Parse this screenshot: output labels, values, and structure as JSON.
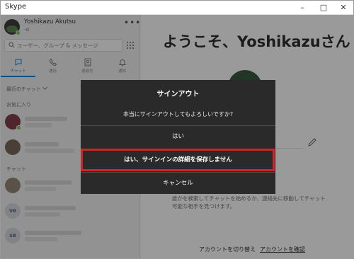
{
  "window": {
    "title": "Skype"
  },
  "sidebar": {
    "profile": {
      "name": "Yoshikazu Akutsu",
      "status": "-d"
    },
    "search": {
      "placeholder": "ユーザー、グループ & メッセージ"
    },
    "tabs": [
      {
        "label": "チャット",
        "icon": "chat-icon",
        "active": true
      },
      {
        "label": "通話",
        "icon": "phone-icon",
        "active": false
      },
      {
        "label": "連絡先",
        "icon": "contacts-icon",
        "active": false
      },
      {
        "label": "通知",
        "icon": "bell-icon",
        "active": false
      }
    ],
    "recent_label": "最近のチャット",
    "favorites_label": "お気に入り",
    "chats_label": "チャット",
    "contacts_initials": [
      "VB",
      "SB"
    ]
  },
  "main": {
    "welcome": "ようこそ、Yoshikazuさん",
    "helper_text": "誰かを検索してチャットを始めるか、連絡先に移動してチャット可能な相手を見つけます。",
    "footer": {
      "switch_account": "アカウントを切り替え",
      "verify_account": "アカウントを確認"
    }
  },
  "dialog": {
    "title": "サインアウト",
    "message": "本当にサインアウトしてもよろしいですか?",
    "yes": "はい",
    "yes_no_save": "はい、サインインの詳細を保存しません",
    "cancel": "キャンセル"
  },
  "colors": {
    "accent": "#0078d4",
    "highlight": "#d3232a",
    "dialog_bg": "#2a2a2a"
  }
}
